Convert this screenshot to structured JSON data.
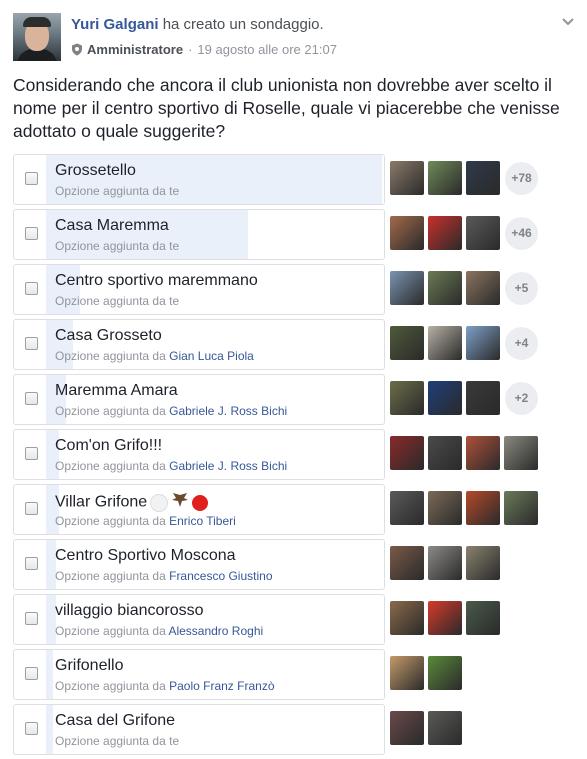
{
  "post": {
    "author": "Yuri Galgani",
    "action": "ha creato un sondaggio.",
    "role": "Amministratore",
    "role_icon": "shield-icon",
    "timestamp": "19 agosto alle ore 21:07",
    "dot": "·",
    "menu_icon": "chevron-down-icon",
    "question": "Considerando che ancora il club unionista non dovrebbe aver scelto il nome per il centro sportivo di Roselle, quale vi piacerebbe che venisse adottato o quale suggerite?"
  },
  "poll": {
    "options": [
      {
        "title": "Grossetello",
        "added_by_prefix": "Opzione aggiunta da",
        "added_by": "te",
        "fill_pct": 100,
        "voters": [
          "#8b7a6a",
          "#6f8a5a",
          "#2f3a4a"
        ],
        "more": "+78"
      },
      {
        "title": "Casa Maremma",
        "added_by_prefix": "Opzione aggiunta da",
        "added_by": "te",
        "fill_pct": 60,
        "voters": [
          "#a26a4a",
          "#c9302c",
          "#5a5a5a"
        ],
        "more": "+46"
      },
      {
        "title": "Centro sportivo maremmano",
        "added_by_prefix": "Opzione aggiunta da",
        "added_by": "te",
        "fill_pct": 10,
        "voters": [
          "#7a94b2",
          "#6b7a54",
          "#8a7460"
        ],
        "more": "+5"
      },
      {
        "title": "Casa Grosseto",
        "added_by_prefix": "Opzione aggiunta da",
        "added_by": "Gian Luca Piola",
        "fill_pct": 8,
        "voters": [
          "#4e5a3a",
          "#b7b0a5",
          "#7ea0c8"
        ],
        "more": "+4"
      },
      {
        "title": "Maremma Amara",
        "added_by_prefix": "Opzione aggiunta da",
        "added_by": "Gabriele J. Ross Bichi",
        "fill_pct": 6,
        "voters": [
          "#6c6e48",
          "#1f3f7a",
          "#3a3a3a"
        ],
        "more": "+2"
      },
      {
        "title": "Com'on Grifo!!!",
        "added_by_prefix": "Opzione aggiunta da",
        "added_by": "Gabriele J. Ross Bichi",
        "fill_pct": 4,
        "voters": [
          "#8a2a2a",
          "#4a4a4a",
          "#b0503a",
          "#8a8a80"
        ],
        "more": ""
      },
      {
        "title": "Villar Grifone",
        "title_suffix": "⚪🦅🔴",
        "added_by_prefix": "Opzione aggiunta da",
        "added_by": "Enrico Tiberi",
        "fill_pct": 4,
        "voters": [
          "#5a5a5a",
          "#7b6a58",
          "#b44a2a",
          "#6a7a5a"
        ],
        "more": ""
      },
      {
        "title": "Centro Sportivo Moscona",
        "added_by_prefix": "Opzione aggiunta da",
        "added_by": "Francesco Giustino",
        "fill_pct": 3,
        "voters": [
          "#7a5a48",
          "#8c8a88",
          "#8a8270"
        ],
        "more": ""
      },
      {
        "title": "villaggio biancorosso",
        "added_by_prefix": "Opzione aggiunta da",
        "added_by": "Alessandro Roghi",
        "fill_pct": 3,
        "voters": [
          "#8a6a4a",
          "#d63a2a",
          "#4a5a4a"
        ],
        "more": ""
      },
      {
        "title": "Grifonello",
        "added_by_prefix": "Opzione aggiunta da",
        "added_by": "Paolo Franz Franzò",
        "fill_pct": 2,
        "voters": [
          "#c49a6a",
          "#5a8a3a"
        ],
        "more": ""
      },
      {
        "title": "Casa del Grifone",
        "added_by_prefix": "Opzione aggiunta da",
        "added_by": "te",
        "fill_pct": 2,
        "voters": [
          "#6a4a4a",
          "#5a5a58"
        ],
        "more": ""
      }
    ]
  }
}
